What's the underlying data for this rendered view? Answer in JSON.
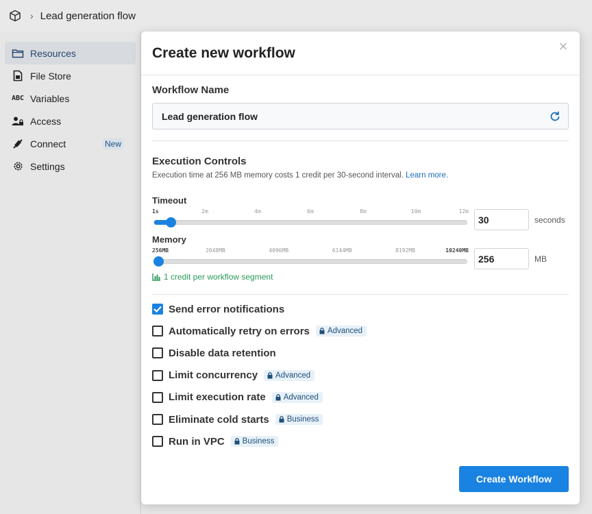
{
  "app": {
    "breadcrumb_title": "Lead generation flow",
    "logo_icon": "cube-icon",
    "separator": "›"
  },
  "sidebar": {
    "items": [
      {
        "label": "Resources",
        "icon": "folder-icon",
        "active": true
      },
      {
        "label": "File Store",
        "icon": "file-icon"
      },
      {
        "label": "Variables",
        "icon": "abc-icon",
        "glyph": "ABC"
      },
      {
        "label": "Access",
        "icon": "users-lock-icon"
      },
      {
        "label": "Connect",
        "icon": "plug-icon",
        "badge": "New"
      },
      {
        "label": "Settings",
        "icon": "gear-icon"
      }
    ]
  },
  "modal": {
    "title": "Create new workflow",
    "close": "×",
    "name_label": "Workflow Name",
    "name_value": "Lead generation flow",
    "exec_title": "Execution Controls",
    "exec_desc": "Execution time at 256 MB memory costs 1 credit per 30-second interval.",
    "learn_more": "Learn more.",
    "timeout": {
      "label": "Timeout",
      "ticks": [
        "1s",
        "2m",
        "4m",
        "6m",
        "8m",
        "10m",
        "12m"
      ],
      "value": "30",
      "unit": "seconds",
      "fraction": 0.04
    },
    "memory": {
      "label": "Memory",
      "ticks": [
        "256MB",
        "2048MB",
        "4096MB",
        "6144MB",
        "8192MB",
        "10240MB"
      ],
      "value": "256",
      "unit": "MB",
      "fraction": 0.0
    },
    "credit_note": "1 credit per workflow segment",
    "options": [
      {
        "label": "Send error notifications",
        "checked": true,
        "badge": ""
      },
      {
        "label": "Automatically retry on errors",
        "checked": false,
        "badge": "Advanced"
      },
      {
        "label": "Disable data retention",
        "checked": false,
        "badge": ""
      },
      {
        "label": "Limit concurrency",
        "checked": false,
        "badge": "Advanced"
      },
      {
        "label": "Limit execution rate",
        "checked": false,
        "badge": "Advanced"
      },
      {
        "label": "Eliminate cold starts",
        "checked": false,
        "badge": "Business"
      },
      {
        "label": "Run in VPC",
        "checked": false,
        "badge": "Business"
      }
    ],
    "submit_label": "Create Workflow"
  },
  "colors": {
    "accent": "#1a82e0",
    "credit_green": "#2a9a5a",
    "badge_bg": "#e8f1f8"
  }
}
